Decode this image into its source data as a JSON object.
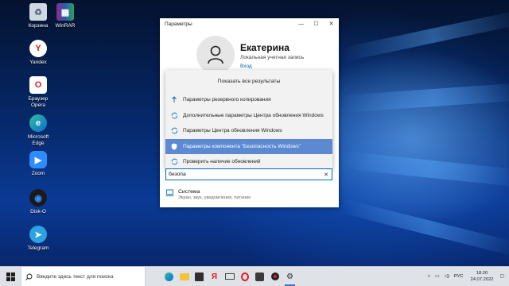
{
  "desktop": {
    "icons": [
      {
        "label": "Корзина",
        "icon": "recycle-bin-icon"
      },
      {
        "label": "WinRAR",
        "icon": "winrar-icon"
      },
      {
        "label": "Yandex",
        "icon": "yandex-icon"
      },
      {
        "label": "Браузер Opera",
        "icon": "opera-icon"
      },
      {
        "label": "Microsoft Edge",
        "icon": "edge-icon"
      },
      {
        "label": "Zoom",
        "icon": "zoom-icon"
      },
      {
        "label": "Disk-O",
        "icon": "disk-o-icon"
      },
      {
        "label": "Telegram",
        "icon": "telegram-icon"
      }
    ]
  },
  "settings_window": {
    "title": "Параметры",
    "user": {
      "name": "Екатерина",
      "type": "Локальная учетная запись",
      "login": "Вход"
    },
    "dropdown": {
      "show_all": "Показать все результаты",
      "results": [
        {
          "label": "Параметры резервного копирования",
          "icon": "backup-arrow-icon",
          "active": false
        },
        {
          "label": "Дополнительные параметры Центра обновления Windows",
          "icon": "update-sync-icon",
          "active": false
        },
        {
          "label": "Параметры Центра обновления Windows",
          "icon": "update-sync-icon",
          "active": false
        },
        {
          "label": "Параметры компонента \"Безопасность Windows\"",
          "icon": "shield-icon",
          "active": true
        },
        {
          "label": "Проверить наличие обновлений",
          "icon": "update-sync-icon",
          "active": false
        }
      ]
    },
    "search": {
      "value": "безопа",
      "clear": "✕"
    },
    "category": {
      "title": "Система",
      "subtitle": "Экран, звук, уведомления, питание"
    }
  },
  "taskbar": {
    "search_placeholder": "Введите здесь текст для поиска",
    "language": "РУС",
    "time": "18:20",
    "date": "24.07.2022"
  },
  "colors": {
    "accent": "#0067c0",
    "active_result": "#5b8ad2"
  }
}
